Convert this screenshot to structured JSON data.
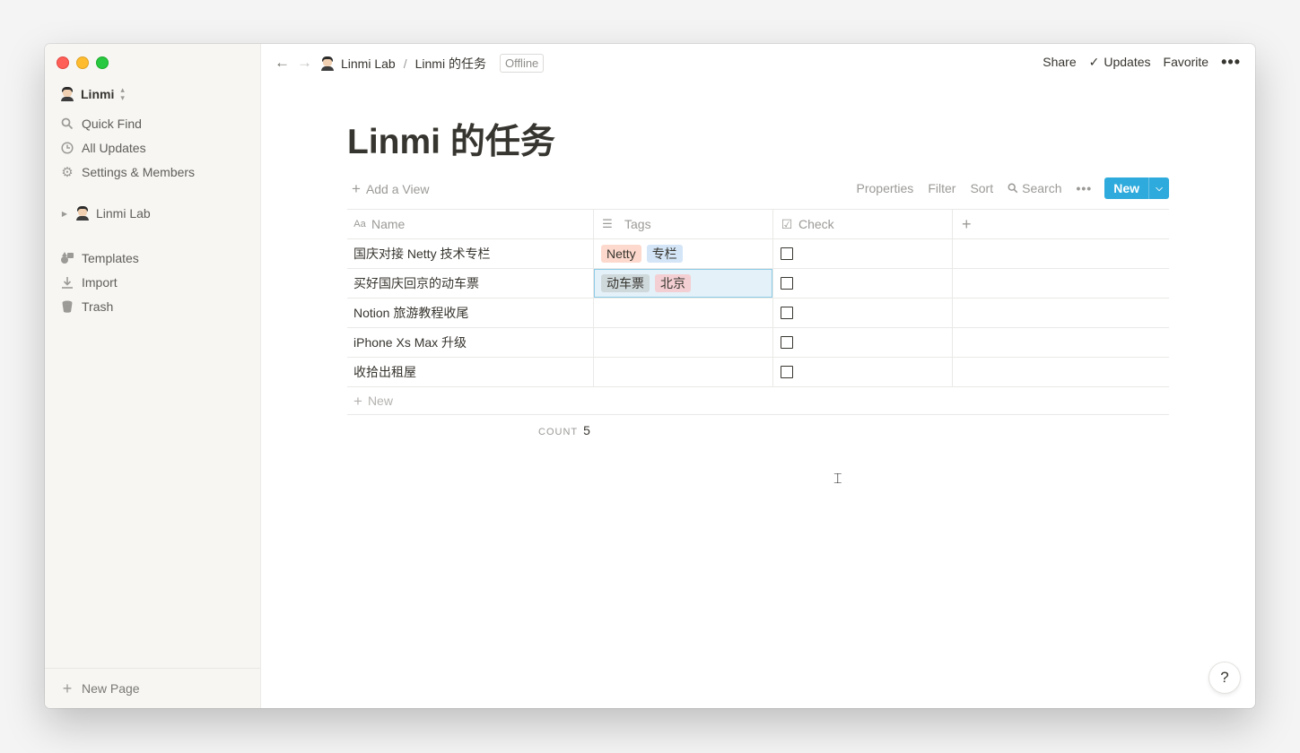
{
  "workspace": {
    "name": "Linmi"
  },
  "sidebar": {
    "items": [
      {
        "label": "Quick Find",
        "icon": "search-icon"
      },
      {
        "label": "All Updates",
        "icon": "clock-icon"
      },
      {
        "label": "Settings & Members",
        "icon": "gear-icon"
      }
    ],
    "pages": [
      {
        "label": "Linmi Lab"
      }
    ],
    "tools": [
      {
        "label": "Templates",
        "icon": "templates-icon"
      },
      {
        "label": "Import",
        "icon": "import-icon"
      },
      {
        "label": "Trash",
        "icon": "trash-icon"
      }
    ],
    "new_page": "New Page"
  },
  "topbar": {
    "breadcrumb": [
      "Linmi Lab",
      "Linmi 的任务"
    ],
    "separator": "/",
    "status": "Offline",
    "share": "Share",
    "updates": "Updates",
    "favorite": "Favorite"
  },
  "page": {
    "title": "Linmi 的任务"
  },
  "toolbar": {
    "add_view": "Add a View",
    "properties": "Properties",
    "filter": "Filter",
    "sort": "Sort",
    "search": "Search",
    "new": "New"
  },
  "table": {
    "columns": [
      "Name",
      "Tags",
      "Check"
    ],
    "rows": [
      {
        "name": "国庆对接 Netty 技术专栏",
        "tags": [
          {
            "label": "Netty",
            "color": "#fdd9cd"
          },
          {
            "label": "专栏",
            "color": "#d3e5f7"
          }
        ],
        "checked": false
      },
      {
        "name": "买好国庆回京的动车票",
        "tags": [
          {
            "label": "动车票",
            "color": "#cfd8db"
          },
          {
            "label": "北京",
            "color": "#f3cfd3"
          }
        ],
        "checked": false
      },
      {
        "name": "Notion 旅游教程收尾",
        "tags": [],
        "checked": false
      },
      {
        "name": "iPhone Xs Max 升级",
        "tags": [],
        "checked": false
      },
      {
        "name": "收拾出租屋",
        "tags": [],
        "checked": false
      }
    ],
    "new_row": "New",
    "count_label": "COUNT",
    "count_value": "5"
  },
  "help": "?"
}
